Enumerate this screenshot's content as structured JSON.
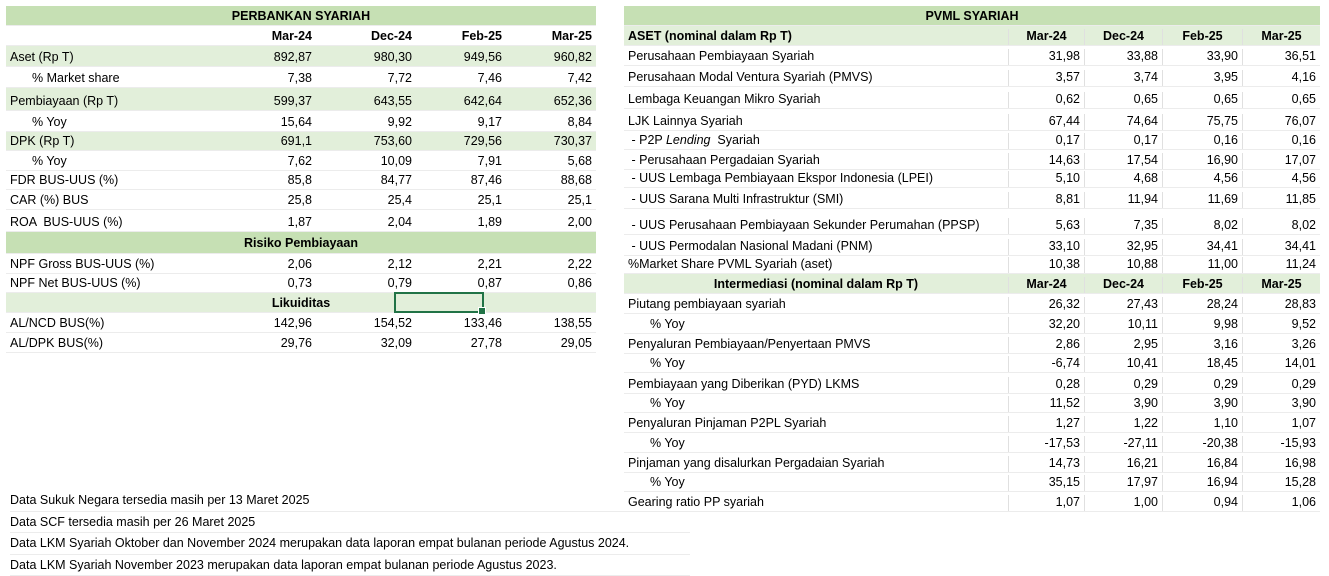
{
  "left": {
    "title": "PERBANKAN SYARIAH",
    "headers": [
      "",
      "Mar-24",
      "Dec-24",
      "Feb-25",
      "Mar-25"
    ],
    "rows": [
      {
        "label": "Aset (Rp T)",
        "values": [
          "892,87",
          "980,30",
          "949,56",
          "960,82"
        ],
        "green": true
      },
      {
        "label": "% Market share",
        "values": [
          "7,38",
          "7,72",
          "7,46",
          "7,42"
        ],
        "indent": true
      },
      {
        "label": "Pembiayaan (Rp T)",
        "values": [
          "599,37",
          "643,55",
          "642,64",
          "652,36"
        ],
        "green": true
      },
      {
        "label": "% Yoy",
        "values": [
          "15,64",
          "9,92",
          "9,17",
          "8,84"
        ],
        "indent": true
      },
      {
        "label": "DPK (Rp T)",
        "values": [
          "691,1",
          "753,60",
          "729,56",
          "730,37"
        ],
        "green": true
      },
      {
        "label": "% Yoy",
        "values": [
          "7,62",
          "10,09",
          "7,91",
          "5,68"
        ],
        "indent": true
      },
      {
        "label": "FDR BUS-UUS (%)",
        "values": [
          "85,8",
          "84,77",
          "87,46",
          "88,68"
        ]
      },
      {
        "label": "CAR (%) BUS",
        "values": [
          "25,8",
          "25,4",
          "25,1",
          "25,1"
        ]
      },
      {
        "label": "ROA  BUS-UUS (%)",
        "values": [
          "1,87",
          "2,04",
          "1,89",
          "2,00"
        ]
      }
    ],
    "section_risk": "Risiko Pembiayaan",
    "risk_rows": [
      {
        "label": "NPF Gross BUS-UUS (%)",
        "values": [
          "2,06",
          "2,12",
          "2,21",
          "2,22"
        ]
      },
      {
        "label": "NPF Net BUS-UUS (%)",
        "values": [
          "0,73",
          "0,79",
          "0,87",
          "0,86"
        ]
      }
    ],
    "section_liq": "Likuiditas",
    "liq_rows": [
      {
        "label": "AL/NCD BUS(%)",
        "values": [
          "142,96",
          "154,52",
          "133,46",
          "138,55"
        ]
      },
      {
        "label": "AL/DPK BUS(%)",
        "values": [
          "29,76",
          "32,09",
          "27,78",
          "29,05"
        ]
      }
    ]
  },
  "right": {
    "title": "PVML SYARIAH",
    "asset_headers": [
      "ASET (nominal dalam Rp T)",
      "Mar-24",
      "Dec-24",
      "Feb-25",
      "Mar-25"
    ],
    "asset_rows": [
      {
        "label": "Perusahaan Pembiayaan Syariah",
        "values": [
          "31,98",
          "33,88",
          "33,90",
          "36,51"
        ]
      },
      {
        "label": "Perusahaan Modal Ventura Syariah (PMVS)",
        "values": [
          "3,57",
          "3,74",
          "3,95",
          "4,16"
        ]
      },
      {
        "label": "Lembaga Keuangan Mikro Syariah",
        "values": [
          "0,62",
          "0,65",
          "0,65",
          "0,65"
        ]
      },
      {
        "label": "LJK Lainnya Syariah",
        "values": [
          "67,44",
          "74,64",
          "75,75",
          "76,07"
        ]
      },
      {
        "label_pre": " - P2P ",
        "label_it": "Lending",
        "label_post": "  Syariah",
        "values": [
          "0,17",
          "0,17",
          "0,16",
          "0,16"
        ]
      },
      {
        "label": " - Perusahaan Pergadaian Syariah",
        "values": [
          "14,63",
          "17,54",
          "16,90",
          "17,07"
        ]
      },
      {
        "label": " - UUS Lembaga Pembiayaan Ekspor Indonesia (LPEI)",
        "values": [
          "5,10",
          "4,68",
          "4,56",
          "4,56"
        ]
      },
      {
        "label": " - UUS Sarana Multi Infrastruktur (SMI)",
        "values": [
          "8,81",
          "11,94",
          "11,69",
          "11,85"
        ]
      },
      {
        "label": " - UUS Perusahaan Pembiayaan Sekunder Perumahan (PPSP)",
        "values": [
          "5,63",
          "7,35",
          "8,02",
          "8,02"
        ]
      },
      {
        "label": " - UUS Permodalan Nasional Madani (PNM)",
        "values": [
          "33,10",
          "32,95",
          "34,41",
          "34,41"
        ]
      },
      {
        "label": "%Market Share PVML Syariah (aset)",
        "values": [
          "10,38",
          "10,88",
          "11,00",
          "11,24"
        ]
      }
    ],
    "inter_headers": [
      "Intermediasi (nominal dalam Rp T)",
      "Mar-24",
      "Dec-24",
      "Feb-25",
      "Mar-25"
    ],
    "inter_rows": [
      {
        "label": "Piutang pembiayaan syariah",
        "values": [
          "26,32",
          "27,43",
          "28,24",
          "28,83"
        ]
      },
      {
        "label": "% Yoy",
        "values": [
          "32,20",
          "10,11",
          "9,98",
          "9,52"
        ],
        "indent": true
      },
      {
        "label": "Penyaluran Pembiayaan/Penyertaan PMVS",
        "values": [
          "2,86",
          "2,95",
          "3,16",
          "3,26"
        ]
      },
      {
        "label": "% Yoy",
        "values": [
          "-6,74",
          "10,41",
          "18,45",
          "14,01"
        ],
        "indent": true
      },
      {
        "label": "Pembiayaan yang Diberikan (PYD) LKMS",
        "values": [
          "0,28",
          "0,29",
          "0,29",
          "0,29"
        ]
      },
      {
        "label": "% Yoy",
        "values": [
          "11,52",
          "3,90",
          "3,90",
          "3,90"
        ],
        "indent": true
      },
      {
        "label": "Penyaluran Pinjaman P2PL Syariah",
        "values": [
          "1,27",
          "1,22",
          "1,10",
          "1,07"
        ]
      },
      {
        "label": "% Yoy",
        "values": [
          "-17,53",
          "-27,11",
          "-20,38",
          "-15,93"
        ],
        "indent": true
      },
      {
        "label": "Pinjaman yang disalurkan Pergadaian Syariah",
        "values": [
          "14,73",
          "16,21",
          "16,84",
          "16,98"
        ]
      },
      {
        "label": "% Yoy",
        "values": [
          "35,15",
          "17,97",
          "16,94",
          "15,28"
        ],
        "indent": true
      },
      {
        "label": "Gearing ratio PP syariah",
        "values": [
          "1,07",
          "1,00",
          "0,94",
          "1,06"
        ]
      }
    ]
  },
  "notes": [
    "Data Sukuk Negara tersedia masih per 13 Maret 2025",
    "Data SCF tersedia masih per 26 Maret 2025",
    "Data LKM Syariah Oktober dan November 2024 merupakan data laporan empat bulanan periode Agustus 2024.",
    "Data LKM Syariah November 2023 merupakan data laporan empat bulanan periode Agustus 2023."
  ]
}
